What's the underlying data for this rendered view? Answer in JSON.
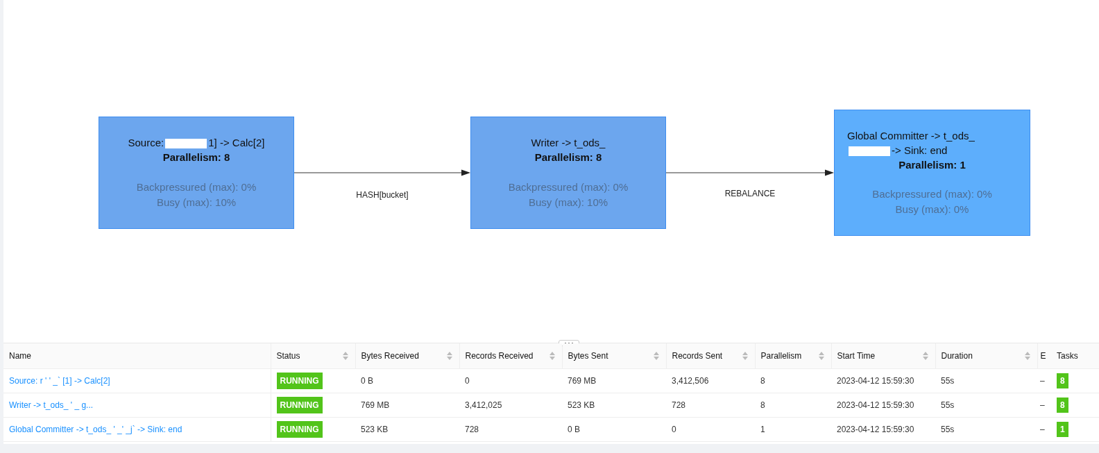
{
  "graph": {
    "nodes": [
      {
        "title_parts": [
          "Source:",
          "1] -> Calc[2]"
        ],
        "parallelism": "Parallelism: 8",
        "backpressured": "Backpressured (max): 0%",
        "busy": "Busy (max): 10%",
        "color": "#6ca6ee"
      },
      {
        "title_parts": [
          "Writer -> t_ods_"
        ],
        "parallelism": "Parallelism: 8",
        "backpressured": "Backpressured (max): 0%",
        "busy": "Busy (max): 10%",
        "color": "#6ca6ee"
      },
      {
        "title_parts": [
          "Global Committer -> t_ods_",
          "-> Sink: end"
        ],
        "parallelism": "Parallelism: 1",
        "backpressured": "Backpressured (max): 0%",
        "busy": "Busy (max): 0%",
        "color": "#5daefc"
      }
    ],
    "edges": [
      {
        "label": "HASH[bucket]"
      },
      {
        "label": "REBALANCE"
      }
    ]
  },
  "table": {
    "columns": [
      {
        "label": "Name",
        "kind": "link",
        "sortable": false
      },
      {
        "label": "Status",
        "kind": "status",
        "sortable": true
      },
      {
        "label": "Bytes Received",
        "kind": "text",
        "sortable": true
      },
      {
        "label": "Records Received",
        "kind": "text",
        "sortable": true
      },
      {
        "label": "Bytes Sent",
        "kind": "text",
        "sortable": true
      },
      {
        "label": "Records Sent",
        "kind": "text",
        "sortable": true
      },
      {
        "label": "Parallelism",
        "kind": "text",
        "sortable": true
      },
      {
        "label": "Start Time",
        "kind": "text",
        "sortable": true
      },
      {
        "label": "Duration",
        "kind": "text",
        "sortable": true
      },
      {
        "label": "E",
        "kind": "text",
        "sortable": false
      },
      {
        "label": "Tasks",
        "kind": "tasks",
        "sortable": false
      }
    ],
    "rows": [
      {
        "cells": [
          "Source: r  '  '  _`  [1] -> Calc[2]",
          "RUNNING",
          "0 B",
          "0",
          "769 MB",
          "3,412,506",
          "8",
          "2023-04-12 15:59:30",
          "55s",
          "–",
          "8"
        ]
      },
      {
        "cells": [
          "Writer -> t_ods_   '  _  g...",
          "RUNNING",
          "769 MB",
          "3,412,025",
          "523 KB",
          "728",
          "8",
          "2023-04-12 15:59:30",
          "55s",
          "–",
          "8"
        ]
      },
      {
        "cells": [
          "Global Committer -> t_ods_   '  _'  _j`   -> Sink: end",
          "RUNNING",
          "523 KB",
          "728",
          "0 B",
          "0",
          "1",
          "2023-04-12 15:59:30",
          "55s",
          "–",
          "1"
        ]
      }
    ]
  }
}
